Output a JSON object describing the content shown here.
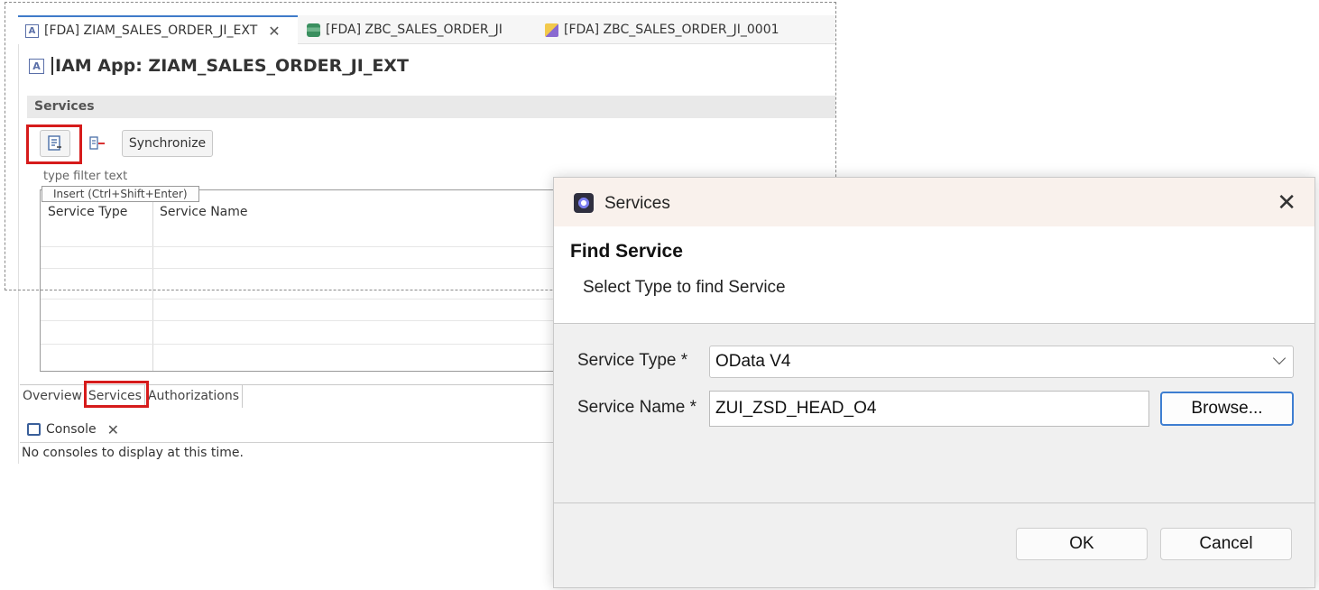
{
  "editor": {
    "tabs": [
      {
        "label": "[FDA] ZIAM_SALES_ORDER_JI_EXT",
        "icon": "app-icon",
        "active": true
      },
      {
        "label": "[FDA] ZBC_SALES_ORDER_JI",
        "icon": "database-icon",
        "active": false
      },
      {
        "label": "[FDA] ZBC_SALES_ORDER_JI_0001",
        "icon": "extension-icon",
        "active": false
      }
    ],
    "title": "IAM App: ZIAM_SALES_ORDER_JI_EXT",
    "section_title": "Services",
    "toolbar": {
      "synchronize_label": "Synchronize"
    },
    "filter_placeholder": "type filter text",
    "tooltip": "Insert (Ctrl+Shift+Enter)",
    "table": {
      "columns": [
        "Service Type",
        "Service Name"
      ]
    },
    "page_tabs": [
      "Overview",
      "Services",
      "Authorizations"
    ],
    "console": {
      "tab_label": "Console",
      "message": "No consoles to display at this time."
    }
  },
  "dialog": {
    "title": "Services",
    "header_title": "Find Service",
    "header_subtitle": "Select Type to find Service",
    "service_type_label": "Service Type *",
    "service_type_value": "OData V4",
    "service_name_label": "Service Name *",
    "service_name_value": "ZUI_ZSD_HEAD_O4",
    "browse_label": "Browse...",
    "ok_label": "OK",
    "cancel_label": "Cancel"
  },
  "colors": {
    "highlight": "#d61b1b",
    "focus_border": "#3e7ed1",
    "title_bar": "#f9f1ec"
  }
}
